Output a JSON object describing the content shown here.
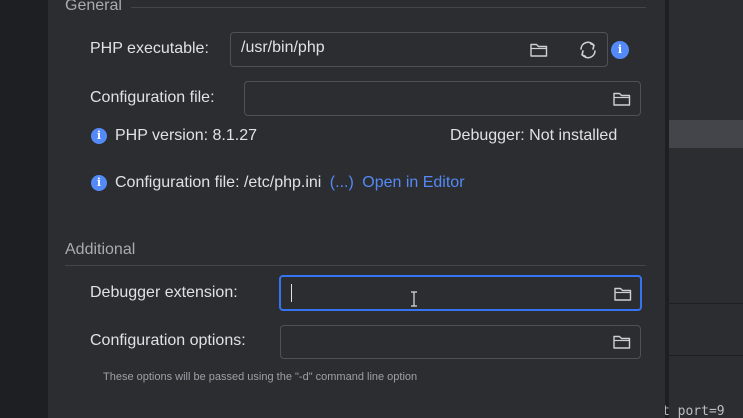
{
  "general": {
    "section_title": "General",
    "php_executable_label": "PHP executable:",
    "php_executable_value": "/usr/bin/php",
    "configuration_file_label": "Configuration file:",
    "configuration_file_value": "",
    "php_version_text": "PHP version: 8.1.27",
    "debugger_text": "Debugger: Not installed",
    "config_info_text": "Configuration file: /etc/php.ini",
    "config_info_more_link": "(...)",
    "open_in_editor_link": "Open in Editor"
  },
  "additional": {
    "section_title": "Additional",
    "debugger_extension_label": "Debugger extension:",
    "debugger_extension_value": "",
    "configuration_options_label": "Configuration options:",
    "configuration_options_value": "",
    "hint_text": "These options will be passed using the \"-d\" command line option"
  },
  "background": {
    "code_fragment": "t port=9"
  },
  "icons": {
    "browse": "folder-icon",
    "reload": "refresh-icon",
    "info": "info-icon"
  },
  "colors": {
    "dialog_bg": "#2b2d30",
    "accent": "#3574f0",
    "link": "#548af7",
    "text": "#dfe1e5"
  }
}
